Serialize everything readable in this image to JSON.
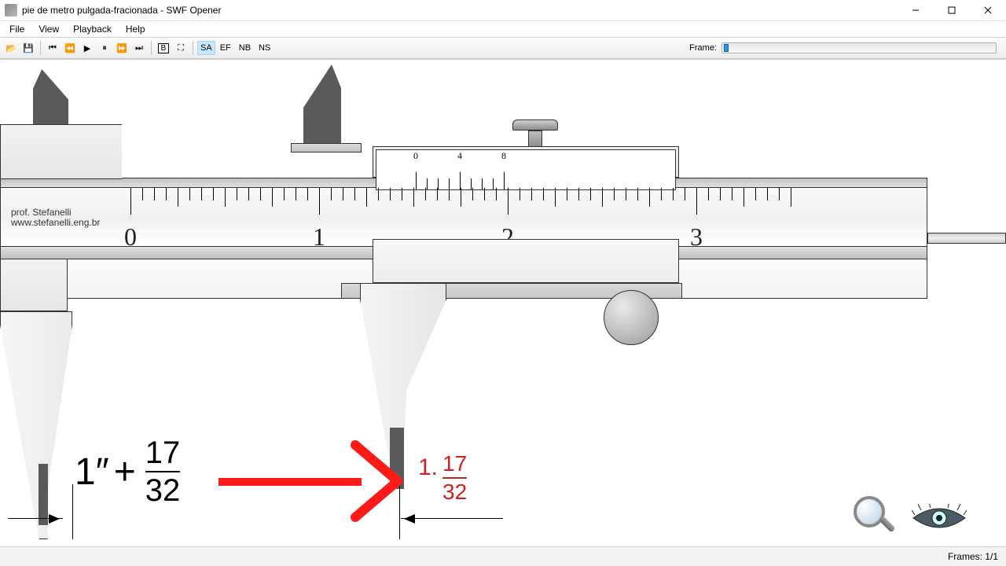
{
  "window": {
    "title": "pie de metro pulgada-fracionada - SWF Opener"
  },
  "menu": {
    "file": "File",
    "view": "View",
    "playback": "Playback",
    "help": "Help"
  },
  "toolbar": {
    "scale_modes": {
      "sa": "SA",
      "ef": "EF",
      "nb": "NB",
      "ns": "NS"
    },
    "frame_label": "Frame:"
  },
  "status": {
    "frames": "Frames: 1/1"
  },
  "credit": {
    "line1": "prof. Stefanelli",
    "line2": "www.stefanelli.eng.br"
  },
  "main_scale": {
    "n0": "0",
    "n1": "1",
    "n2": "2",
    "n3": "3"
  },
  "vernier_scale": {
    "v0": "0",
    "v4": "4",
    "v8": "8"
  },
  "measurement": {
    "whole_in": "1″",
    "plus": "+",
    "frac_num": "17",
    "frac_den": "32",
    "result_whole": "1.",
    "result_num": "17",
    "result_den": "32"
  }
}
